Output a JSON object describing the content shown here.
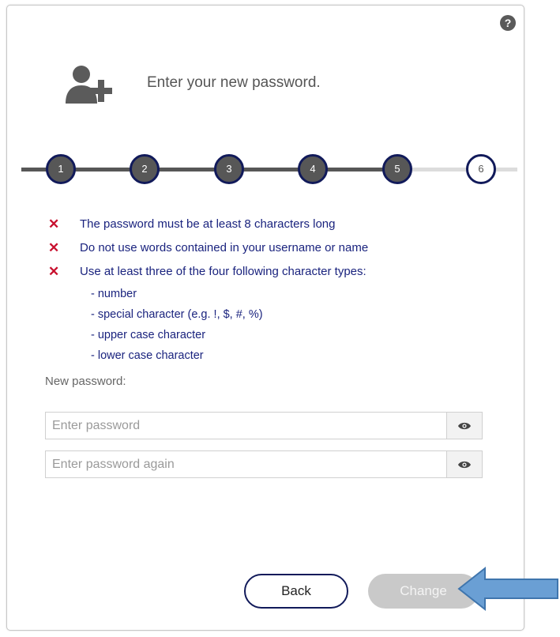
{
  "help": {
    "icon": "question-circle-icon",
    "symbol": "?"
  },
  "header": {
    "icon": "add-user-icon",
    "text": "Enter your new password."
  },
  "stepper": {
    "steps": [
      {
        "label": "1",
        "state": "done"
      },
      {
        "label": "2",
        "state": "done"
      },
      {
        "label": "3",
        "state": "done"
      },
      {
        "label": "4",
        "state": "done"
      },
      {
        "label": "5",
        "state": "done"
      },
      {
        "label": "6",
        "state": "current"
      }
    ]
  },
  "rules": {
    "items": [
      {
        "status": "✕",
        "text": "The password must be at least 8 characters long"
      },
      {
        "status": "✕",
        "text": "Do not use words contained in your username or name"
      },
      {
        "status": "✕",
        "text": "Use at least three of the four following character types:"
      }
    ],
    "types": [
      "- number",
      "- special character (e.g. !, $, #, %)",
      "- upper case character",
      "- lower case character"
    ]
  },
  "form": {
    "label": "New password:",
    "password": {
      "placeholder": "Enter password",
      "value": ""
    },
    "password_again": {
      "placeholder": "Enter password again",
      "value": ""
    },
    "eye_icon": "eye-icon"
  },
  "buttons": {
    "back": "Back",
    "change": "Change"
  },
  "colors": {
    "accent": "#111a5a",
    "step_fill": "#575757",
    "rule_text": "#1a237e",
    "error": "#c8102e",
    "disabled": "#c9c9c9",
    "pointer_arrow": "#6a9fd4"
  }
}
